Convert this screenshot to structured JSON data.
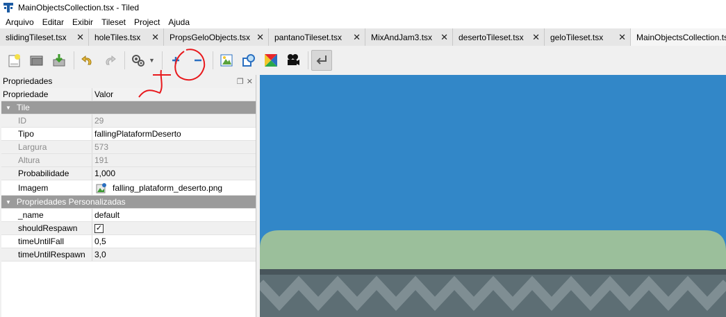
{
  "window": {
    "title": "MainObjectsCollection.tsx - Tiled"
  },
  "menu": [
    "Arquivo",
    "Editar",
    "Exibir",
    "Tileset",
    "Project",
    "Ajuda"
  ],
  "tabs": [
    {
      "label": "slidingTileset.tsx"
    },
    {
      "label": "holeTiles.tsx"
    },
    {
      "label": "PropsGeloObjects.tsx"
    },
    {
      "label": "pantanoTileset.tsx"
    },
    {
      "label": "MixAndJam3.tsx"
    },
    {
      "label": "desertoTileset.tsx"
    },
    {
      "label": "geloTileset.tsx"
    },
    {
      "label": "MainObjectsCollection.tsx",
      "active": true
    }
  ],
  "tab_close_glyph": "✕",
  "toolbar": {
    "icons": [
      "new-tileset-icon",
      "open-icon",
      "save-icon",
      "undo-icon",
      "redo-icon",
      "tileset-properties-icon",
      "add-tile-icon",
      "remove-tile-icon",
      "edit-terrain-icon",
      "collision-editor-icon",
      "wang-sets-icon",
      "animation-editor-icon",
      "dynamic-wrapping-icon"
    ],
    "colors": {
      "add_blue": "#2a6fc0",
      "annotation_red": "#e8181c"
    }
  },
  "properties_panel": {
    "title": "Propriedades",
    "columns": {
      "name": "Propriedade",
      "value": "Valor"
    },
    "groups": [
      {
        "label": "Tile",
        "rows": [
          {
            "name": "ID",
            "value": "29",
            "disabled": true
          },
          {
            "name": "Tipo",
            "value": "fallingPlataformDeserto"
          },
          {
            "name": "Largura",
            "value": "573",
            "disabled": true
          },
          {
            "name": "Altura",
            "value": "191",
            "disabled": true
          },
          {
            "name": "Probabilidade",
            "value": "1,000"
          },
          {
            "name": "Imagem",
            "value": "falling_plataform_deserto.png"
          }
        ]
      },
      {
        "label": "Propriedades Personalizadas",
        "rows": [
          {
            "name": "_name",
            "value": "default"
          },
          {
            "name": "shouldRespawn",
            "value": "✓"
          },
          {
            "name": "timeUntilFall",
            "value": "0,5"
          },
          {
            "name": "timeUntilRespawn",
            "value": "3,0"
          }
        ]
      }
    ]
  },
  "canvas": {
    "background": "#3287c8",
    "platform_top": "#9bbf9b",
    "platform_body": "#5d6e74"
  }
}
